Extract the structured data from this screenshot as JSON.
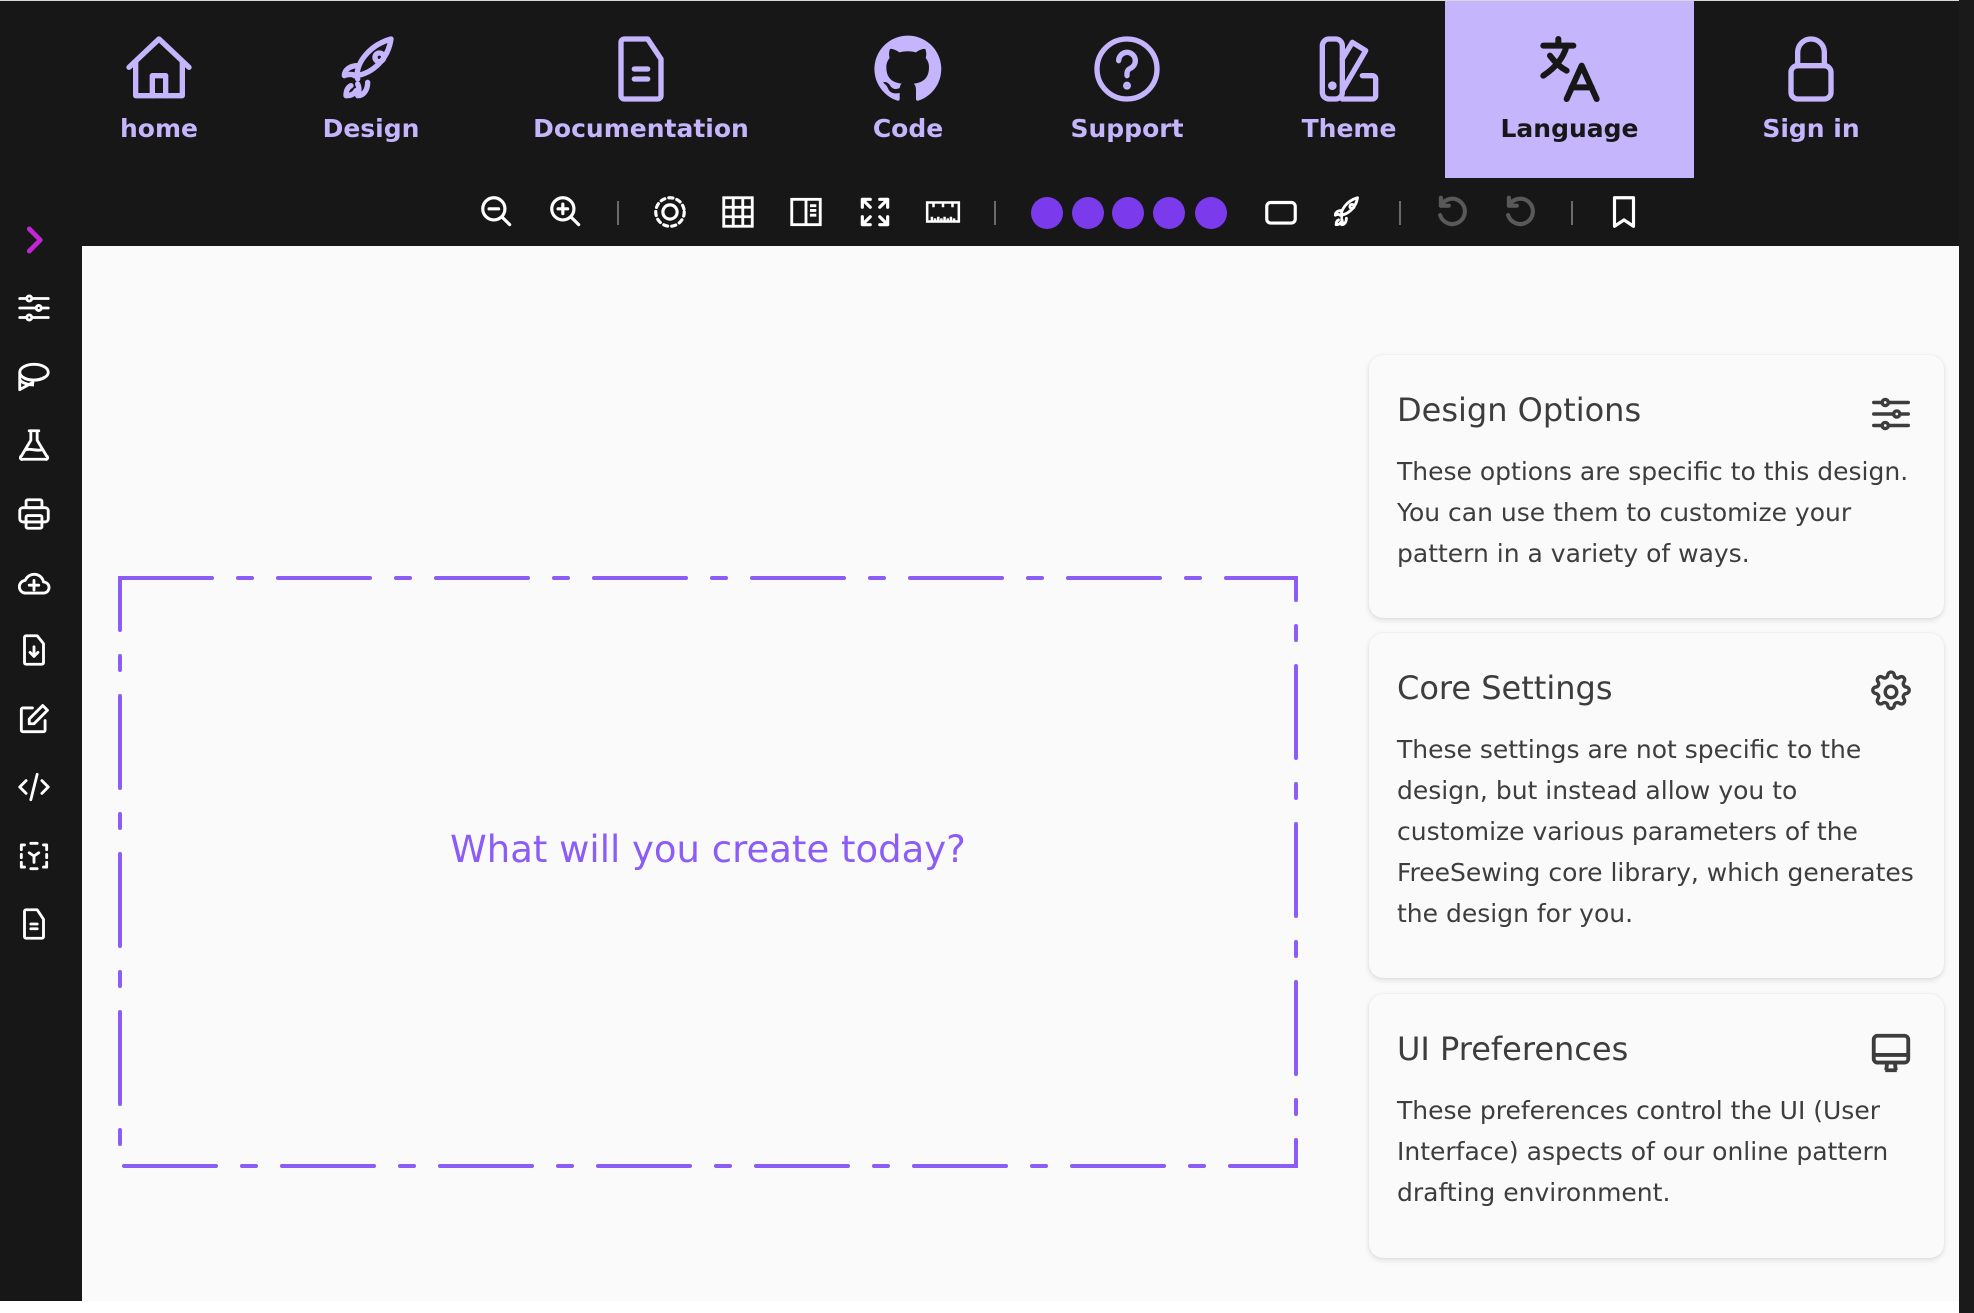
{
  "colors": {
    "accent": "#c4b5fd",
    "dark_bg": "#171717",
    "dash_border": "#8b5cf6",
    "dots": "#7c3aed",
    "chevron": "#c026d3",
    "disabled_icon": "#595959"
  },
  "nav": {
    "items": [
      {
        "label": "home",
        "icon": "home-icon",
        "active": false
      },
      {
        "label": "Design",
        "icon": "rocket-icon",
        "active": false
      },
      {
        "label": "Documentation",
        "icon": "document-icon",
        "active": false
      },
      {
        "label": "Code",
        "icon": "github-icon",
        "active": false
      },
      {
        "label": "Support",
        "icon": "help-circle-icon",
        "active": false
      },
      {
        "label": "Theme",
        "icon": "swatch-icon",
        "active": false
      },
      {
        "label": "Language",
        "icon": "translate-icon",
        "active": true
      },
      {
        "label": "Sign in",
        "icon": "lock-icon",
        "active": false
      }
    ]
  },
  "toolbar": {
    "items": [
      {
        "name": "zoom-out",
        "icon": "zoom-out-icon"
      },
      {
        "name": "zoom-in",
        "icon": "zoom-in-icon"
      },
      {
        "name": "separator"
      },
      {
        "name": "focus",
        "icon": "dashed-circle-icon"
      },
      {
        "name": "grid",
        "icon": "grid-icon"
      },
      {
        "name": "layout",
        "icon": "sidebar-layout-icon"
      },
      {
        "name": "fullscreen",
        "icon": "expand-icon"
      },
      {
        "name": "ruler",
        "icon": "ruler-icon"
      },
      {
        "name": "separator"
      },
      {
        "name": "rendering-level",
        "icon": "dots",
        "count": 5,
        "filled": 5
      },
      {
        "name": "paperless",
        "icon": "square-icon"
      },
      {
        "name": "expand",
        "icon": "rocket-icon"
      },
      {
        "name": "separator"
      },
      {
        "name": "undo",
        "icon": "undo-icon",
        "disabled": true
      },
      {
        "name": "undo-all",
        "icon": "undo-icon",
        "disabled": true
      },
      {
        "name": "separator"
      },
      {
        "name": "bookmark",
        "icon": "bookmark-icon"
      }
    ]
  },
  "sidebar": {
    "items": [
      {
        "name": "expand",
        "icon": "chevron-right-icon"
      },
      {
        "name": "design-options",
        "icon": "sliders-icon"
      },
      {
        "name": "measurements",
        "icon": "tape-measure-icon"
      },
      {
        "name": "test",
        "icon": "flask-icon"
      },
      {
        "name": "print",
        "icon": "printer-icon"
      },
      {
        "name": "save",
        "icon": "cloud-plus-icon"
      },
      {
        "name": "export",
        "icon": "file-download-icon"
      },
      {
        "name": "edit",
        "icon": "edit-icon"
      },
      {
        "name": "code",
        "icon": "code-icon"
      },
      {
        "name": "inspect",
        "icon": "inspect-icon"
      },
      {
        "name": "docs",
        "icon": "document-icon"
      }
    ]
  },
  "main": {
    "prompt": "What will you create today?"
  },
  "cards": [
    {
      "title": "Design Options",
      "icon": "sliders-icon",
      "description": "These options are specific to this design. You can use them to customize your pattern in a variety of ways."
    },
    {
      "title": "Core Settings",
      "icon": "gear-icon",
      "description": "These settings are not specific to the design, but instead allow you to customize various parameters of the FreeSewing core library, which generates the design for you."
    },
    {
      "title": "UI Preferences",
      "icon": "monitor-icon",
      "description": "These preferences control the UI (User Interface) aspects of our online pattern drafting environment."
    }
  ]
}
